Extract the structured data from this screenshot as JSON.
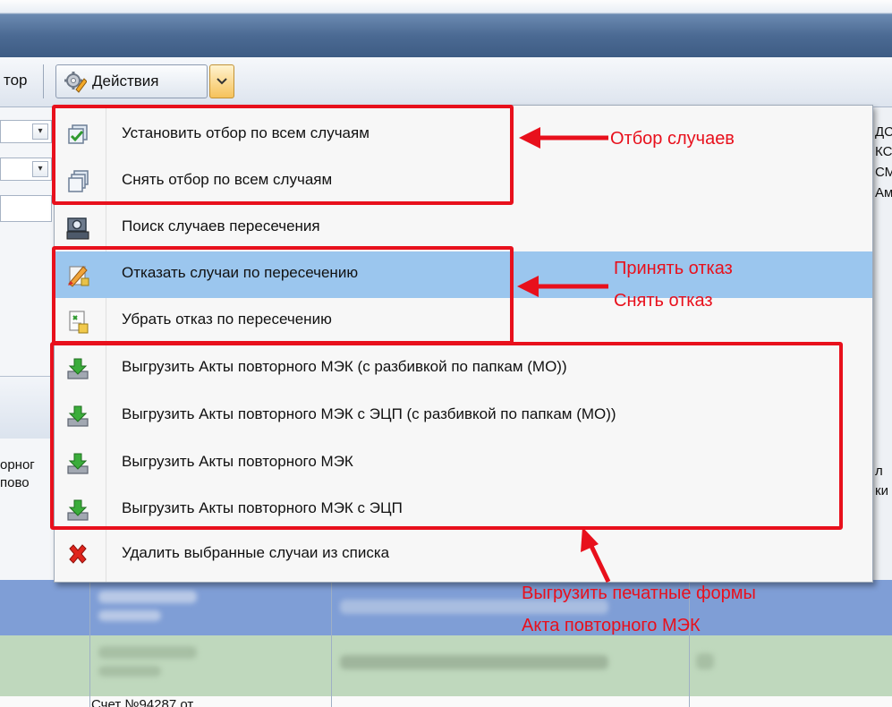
{
  "toolbar": {
    "fragment_label": "тор",
    "actions_label": "Действия"
  },
  "left_fragments": {
    "head_line1": "орног",
    "head_line2": "пово"
  },
  "right_fragments": [
    "ДС",
    "КС",
    "СМ",
    "Ам",
    "л",
    "ки"
  ],
  "bottom_fragment": "Счет №94287 от",
  "menu": {
    "items": [
      {
        "label": "Установить отбор по всем случаям",
        "icon": "checked-copies-icon"
      },
      {
        "label": "Снять отбор по всем случаям",
        "icon": "copies-icon"
      },
      {
        "label": "Поиск случаев пересечения",
        "icon": "search-cases-icon"
      },
      {
        "label": "Отказать случаи по пересечению",
        "icon": "reject-pencil-icon"
      },
      {
        "label": "Убрать отказ по пересечению",
        "icon": "remove-reject-icon"
      },
      {
        "label": "Выгрузить Акты повторного МЭК (с разбивкой по папкам (МО))",
        "icon": "download-arrow-icon"
      },
      {
        "label": "Выгрузить Акты повторного МЭК с ЭЦП (с разбивкой по папкам (МО))",
        "icon": "download-arrow-icon"
      },
      {
        "label": "Выгрузить Акты повторного МЭК",
        "icon": "download-arrow-icon"
      },
      {
        "label": "Выгрузить Акты повторного МЭК с ЭЦП",
        "icon": "download-arrow-icon"
      },
      {
        "label": "Удалить выбранные случаи из списка",
        "icon": "delete-x-icon"
      }
    ],
    "highlighted_index": 3
  },
  "annotations": {
    "selection": "Отбор случаев",
    "reject_line1": "Принять отказ",
    "reject_line2": "Снять отказ",
    "export_line1": "Выгрузить печатные формы",
    "export_line2": "Акта повторного МЭК"
  },
  "colors": {
    "annotation_red": "#e8101c",
    "menu_highlight": "#9bc6ee",
    "title_bar": "#4b6a93"
  }
}
